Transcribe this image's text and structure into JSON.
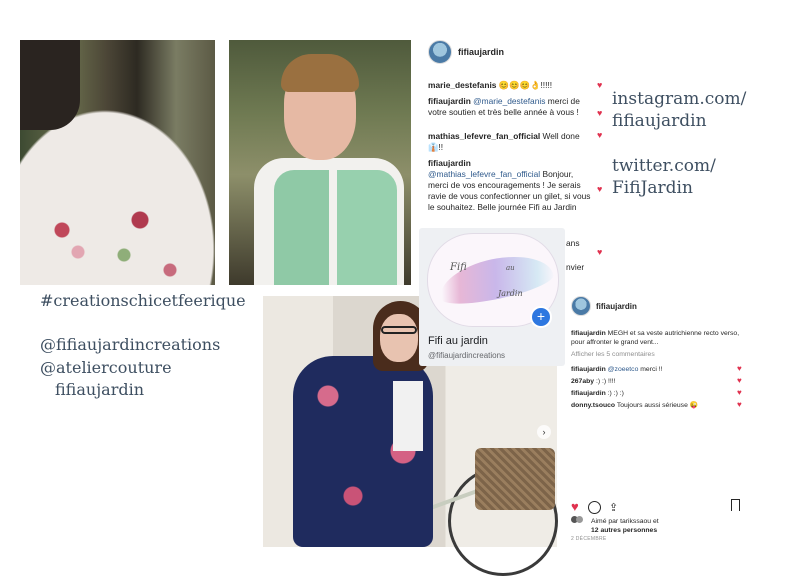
{
  "photos": {
    "back": "photo-back",
    "front": "photo-front",
    "bike": "photo-bike"
  },
  "post1": {
    "username": "fifiaujardin",
    "comments": [
      {
        "user": "marie_destefanis",
        "text": " 😊😊😊👌!!!!!"
      },
      {
        "user": "fifiaujardin",
        "mention": "@marie_destefanis",
        "text": " merci de votre soutien et très belle année à vous !"
      },
      {
        "user": "mathias_lefevre_fan_official",
        "text": " Well done 👔!!"
      },
      {
        "user": "fifiaujardin",
        "mention": "@mathias_lefevre_fan_official",
        "text": " Bonjour, merci de vos encouragements ! Je serais ravie de vous confectionner un gilet, si vous le souhaitez. Belle journée Fifi au Jardin"
      }
    ],
    "partial_1": "ans",
    "partial_2": "nvier"
  },
  "fb_card": {
    "script_1": "Fifi",
    "script_2": "au",
    "script_3": "Jardin",
    "name": "Fifi au jardin",
    "handle": "@fifiaujardincreations",
    "plus": "+"
  },
  "post2": {
    "username": "fifiaujardin",
    "caption_user": "fifiaujardin",
    "caption": " MEGH et sa veste autrichienne recto verso, pour affronter le grand vent...",
    "view_all": "Afficher les 5 commentaires",
    "comments": [
      {
        "user": "fifiaujardin",
        "mention": "@zoeetco",
        "text": " merci !!"
      },
      {
        "user": "267aby",
        "text": " :) :) !!!!"
      },
      {
        "user": "fifiaujardin",
        "text": " :) :) :)"
      },
      {
        "user": "donny.tsouco",
        "text": " Toujours aussi sérieuse 😜"
      }
    ],
    "likes_line1": "Aimé par tarikssaou et",
    "likes_line2": "12 autres personnes",
    "date": "2 DÉCEMBRE"
  },
  "overlay": {
    "instagram_1": "instagram.com/",
    "instagram_2": "fifiaujardin",
    "twitter_1": "twitter.com/",
    "twitter_2": "FifiJardin",
    "hashtag": "#creationschicetfeerique",
    "handle_1": "@fifiaujardincreations",
    "handle_2": "@ateliercouture",
    "handle_3": "fifiaujardin"
  },
  "colors": {
    "heart": "#e0324f",
    "overlay_text": "#3e4f61",
    "link": "#2f5a8c",
    "fb_plus": "#2d77e0"
  },
  "icons": [
    "heart-icon",
    "comment-icon",
    "share-icon",
    "bookmark-icon",
    "plus-icon",
    "arrow-icon"
  ]
}
